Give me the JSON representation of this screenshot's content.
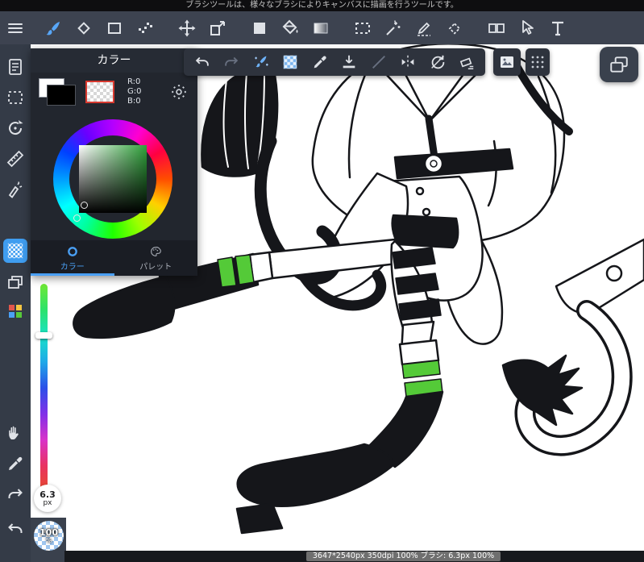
{
  "notification": {
    "text": "ブラシツールは、様々なブラシによりキャンバスに描画を行うツールです。"
  },
  "top_toolbar": {
    "menu": [
      "menu"
    ],
    "groups": [
      [
        {
          "name": "brush",
          "active": true
        },
        "eraser",
        "rect-tool",
        "dot-pen"
      ],
      [
        "move",
        "transform"
      ],
      [
        "fill-square",
        "bucket",
        "gradient"
      ],
      [
        "select-rect",
        "magic-wand",
        "select-pen",
        "select-eraser"
      ],
      [
        "split-view",
        "cursor",
        "text-tool"
      ]
    ]
  },
  "sidebar": {
    "group_top": [
      "pages",
      "select-marquee",
      "rotate-view",
      "ruler",
      "airbrush"
    ],
    "group_tools": [
      {
        "name": "halftone",
        "active": true
      },
      "layers",
      "materials"
    ],
    "group_nav": [
      "hand",
      "eyedropper",
      "redo"
    ],
    "group_bottom": [
      "undo"
    ]
  },
  "floating_toolbar": {
    "icons": [
      "undo",
      {
        "name": "redo",
        "disabled": true
      },
      "brush-sparkle",
      "checker-pattern",
      "eyedropper",
      "save",
      {
        "name": "line",
        "disabled": true
      },
      "symmetry",
      "rotate-reset",
      "clear"
    ]
  },
  "aux": {
    "image_btn": [
      "image"
    ],
    "grid_btn": [
      "grid-dots"
    ],
    "overview_btn": [
      "overview"
    ]
  },
  "color_panel": {
    "title": "カラー",
    "rgb_lines": [
      "R:0",
      "G:0",
      "B:0"
    ],
    "tabs": [
      {
        "label": "カラー",
        "active": true
      },
      {
        "label": "パレット",
        "active": false
      }
    ]
  },
  "badges": {
    "size": {
      "value": "6.3",
      "unit": "px"
    },
    "opacity": {
      "value": "100",
      "unit": "%"
    }
  },
  "status_bar": {
    "text": "3647*2540px 350dpi 100% ブラシ: 6.3px 100%"
  },
  "colors": {
    "accent": "#4aa0f5",
    "stripe_green": "#54ca38",
    "canvas_bg": "#ffffff"
  }
}
